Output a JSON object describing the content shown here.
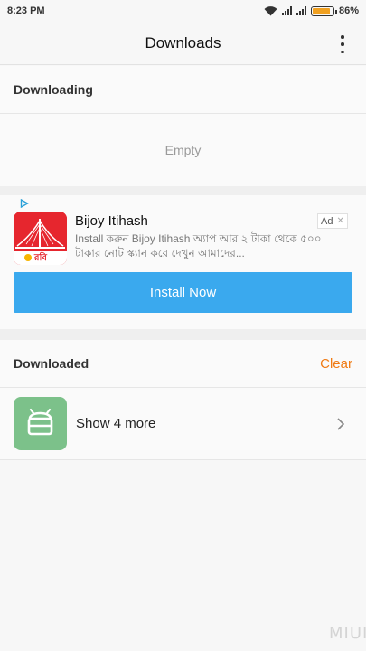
{
  "status_bar": {
    "time": "8:23 PM",
    "battery": "86%",
    "battery_level": 0.86
  },
  "header": {
    "title": "Downloads"
  },
  "downloading": {
    "label": "Downloading",
    "empty_text": "Empty"
  },
  "ad": {
    "title": "Bijoy Itihash",
    "badge": "Ad",
    "description": "Install করুন Bijoy Itihash অ্যাপ আর ২ টাকা থেকে ৫০০ টাকার নোট স্ক্যান করে দেখুন আমাদের...",
    "icon_text": "রবি",
    "install_label": "Install Now",
    "colors": {
      "button": "#3aa9ee",
      "icon_bg": "#e6262e"
    }
  },
  "downloaded": {
    "label": "Downloaded",
    "clear_label": "Clear",
    "more_label": "Show 4 more"
  },
  "watermark": "MIUI",
  "colors": {
    "accent": "#f07b14",
    "app_icon": "#7cc18a"
  }
}
